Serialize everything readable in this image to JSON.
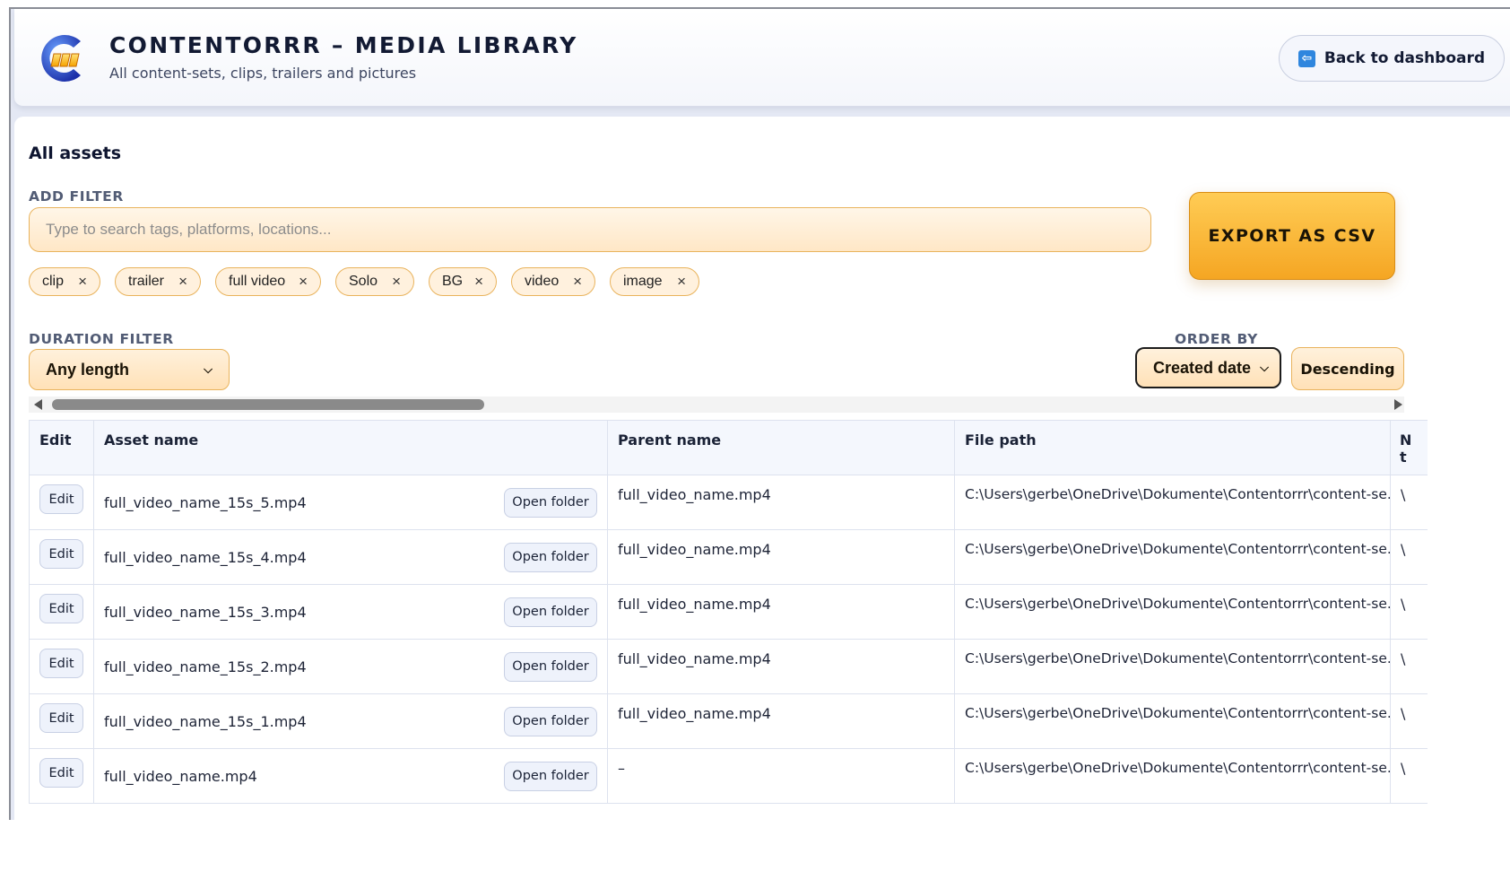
{
  "header": {
    "title": "CONTENTORRR – MEDIA LIBRARY",
    "subtitle": "All content-sets, clips, trailers and pictures",
    "back_label": "Back to dashboard"
  },
  "section_title": "All assets",
  "filter": {
    "label": "ADD FILTER",
    "placeholder": "Type to search tags, platforms, locations...",
    "chips": [
      "clip",
      "trailer",
      "full video",
      "Solo",
      "BG",
      "video",
      "image"
    ],
    "chip_remove": "×"
  },
  "export_label": "EXPORT AS CSV",
  "duration": {
    "label": "DURATION FILTER",
    "selected": "Any length"
  },
  "order": {
    "label": "ORDER BY",
    "selected": "Created date",
    "direction": "Descending"
  },
  "table": {
    "columns": [
      "Edit",
      "Asset name",
      "Parent name",
      "File path",
      "N t"
    ],
    "edit_label": "Edit",
    "open_folder_label": "Open folder",
    "rows": [
      {
        "name": "full_video_name_15s_5.mp4",
        "parent": "full_video_name.mp4",
        "path": "C:\\Users\\gerbe\\OneDrive\\Dokumente\\Contentorrr\\content-se...",
        "cut": "\\"
      },
      {
        "name": "full_video_name_15s_4.mp4",
        "parent": "full_video_name.mp4",
        "path": "C:\\Users\\gerbe\\OneDrive\\Dokumente\\Contentorrr\\content-se...",
        "cut": "\\"
      },
      {
        "name": "full_video_name_15s_3.mp4",
        "parent": "full_video_name.mp4",
        "path": "C:\\Users\\gerbe\\OneDrive\\Dokumente\\Contentorrr\\content-se...",
        "cut": "\\"
      },
      {
        "name": "full_video_name_15s_2.mp4",
        "parent": "full_video_name.mp4",
        "path": "C:\\Users\\gerbe\\OneDrive\\Dokumente\\Contentorrr\\content-se...",
        "cut": "\\"
      },
      {
        "name": "full_video_name_15s_1.mp4",
        "parent": "full_video_name.mp4",
        "path": "C:\\Users\\gerbe\\OneDrive\\Dokumente\\Contentorrr\\content-se...",
        "cut": "\\"
      },
      {
        "name": "full_video_name.mp4",
        "parent": "–",
        "path": "C:\\Users\\gerbe\\OneDrive\\Dokumente\\Contentorrr\\content-se...",
        "cut": "\\"
      }
    ]
  },
  "colors": {
    "accent_orange": "#f5a623",
    "chip_border": "#e9b35c",
    "back_icon_blue": "#2f86de"
  },
  "icons": {
    "logo": "contentorrr-logo-icon",
    "back": "back-arrow-icon",
    "chip_remove": "close-icon",
    "select": "chevron-down-icon"
  }
}
